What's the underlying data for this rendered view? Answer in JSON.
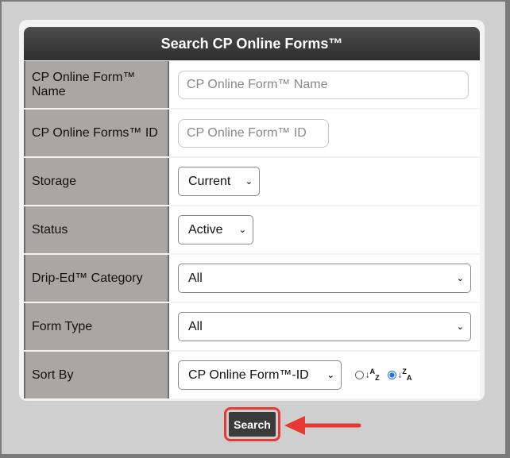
{
  "title": "Search CP Online Forms™",
  "fields": {
    "name": {
      "label": "CP Online Form™ Name",
      "placeholder": "CP Online Form™ Name"
    },
    "id": {
      "label": "CP Online Forms™ ID",
      "placeholder": "CP Online Form™ ID"
    },
    "storage": {
      "label": "Storage",
      "value": "Current"
    },
    "status": {
      "label": "Status",
      "value": "Active"
    },
    "category": {
      "label": "Drip-Ed™ Category",
      "value": "All"
    },
    "form_type": {
      "label": "Form Type",
      "value": "All"
    },
    "sort_by": {
      "label": "Sort By",
      "value": "CP Online Form™-ID",
      "asc_icon": "sort-az-icon",
      "desc_icon": "sort-za-icon",
      "selected": "desc"
    }
  },
  "search_label": "Search",
  "highlight_color": "#e53935"
}
